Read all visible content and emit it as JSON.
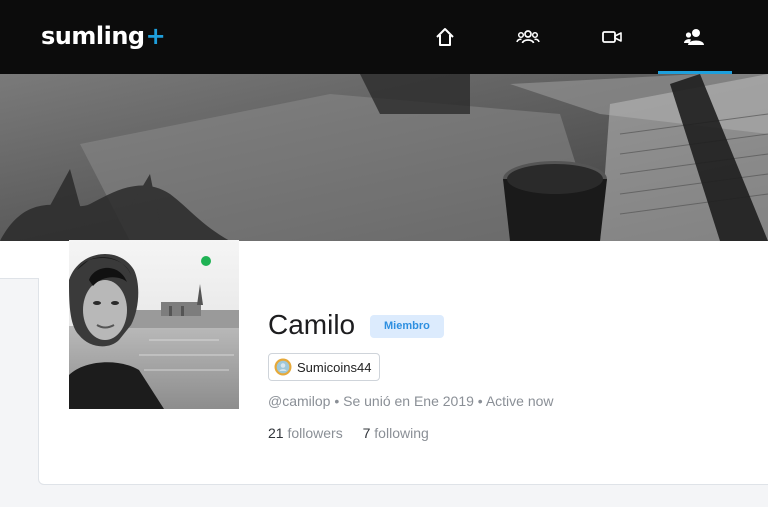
{
  "brand": {
    "name": "sumling",
    "mark": "+",
    "accent": "#1e9fdc"
  },
  "nav": {
    "items": [
      {
        "icon": "home-icon"
      },
      {
        "icon": "groups-icon"
      },
      {
        "icon": "video-icon"
      },
      {
        "icon": "users-icon",
        "active": true
      }
    ]
  },
  "profile": {
    "name": "Camilo",
    "role_badge": "Miembro",
    "coins_label": "Sumicoins44",
    "meta": "@camilop • Se unió en Ene 2019 • Active now",
    "followers_count": "21",
    "followers_label": "followers",
    "following_count": "7",
    "following_label": "following",
    "online": true,
    "status_color": "#1fb254"
  }
}
